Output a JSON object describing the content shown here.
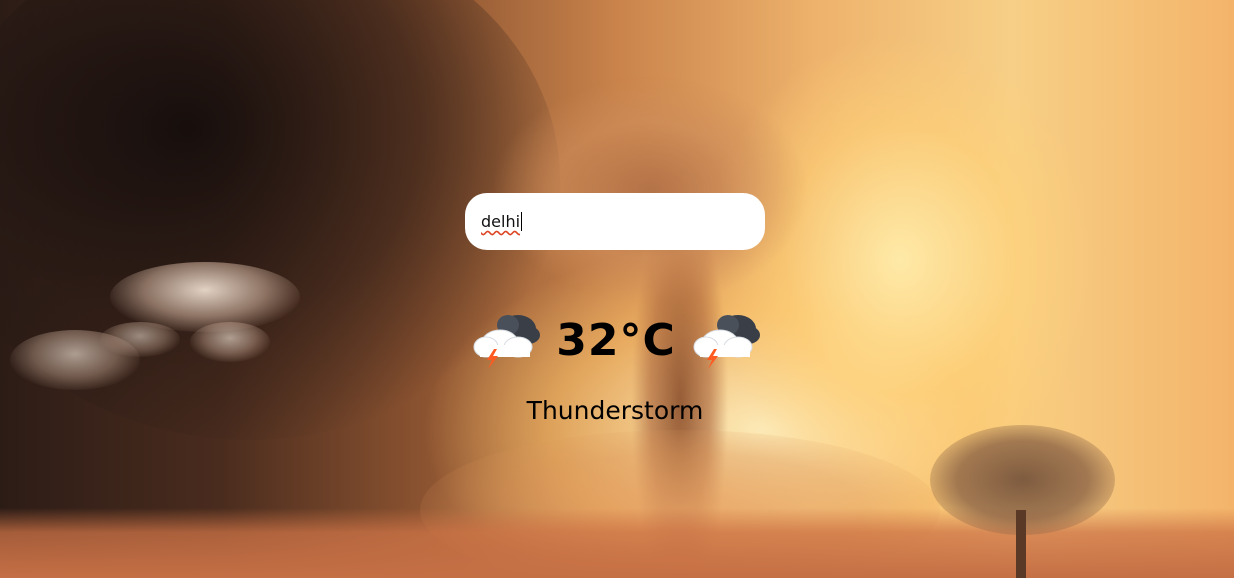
{
  "search": {
    "value": "delhi"
  },
  "weather": {
    "temperature": "32°C",
    "condition": "Thunderstorm",
    "icon_left": "thunderstorm-cloud-icon",
    "icon_right": "thunderstorm-cloud-icon"
  },
  "colors": {
    "input_background": "#ffffff",
    "text": "#000000",
    "lightning": "#ff5a1f"
  }
}
